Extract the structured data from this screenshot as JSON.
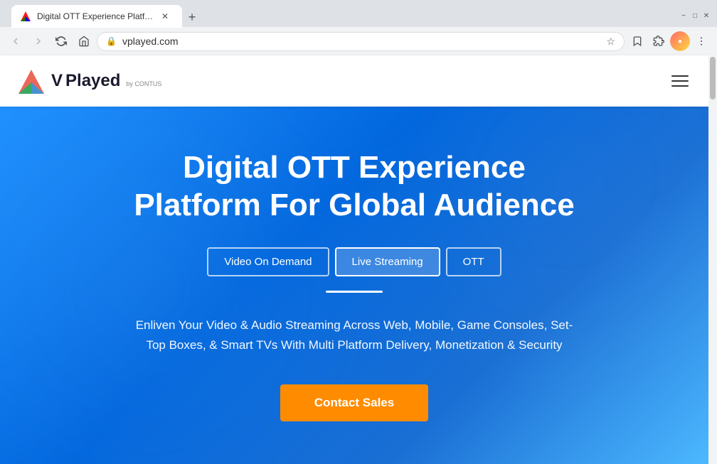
{
  "browser": {
    "title_bar": {
      "tab_title": "Digital OTT Experience Platform",
      "new_tab_label": "+"
    },
    "nav": {
      "address": "vplayed.com",
      "back_title": "Back",
      "forward_title": "Forward",
      "reload_title": "Reload",
      "home_title": "Home"
    },
    "minimize_label": "−",
    "restore_label": "□",
    "close_label": "✕"
  },
  "site": {
    "logo": {
      "brand": "VPlayed",
      "by_text": "by CONTUS"
    },
    "nav": {
      "hamburger_label": "Menu"
    },
    "hero": {
      "title_line1": "Digital OTT Experience",
      "title_line2": "Platform For Global Audience",
      "tabs": [
        {
          "label": "Video On Demand",
          "active": false
        },
        {
          "label": "Live Streaming",
          "active": true
        },
        {
          "label": "OTT",
          "active": false
        }
      ],
      "description": "Enliven Your Video & Audio Streaming Across Web, Mobile, Game Consoles, Set-Top Boxes, & Smart TVs With Multi Platform Delivery, Monetization & Security",
      "cta_button": "Contact Sales"
    }
  }
}
